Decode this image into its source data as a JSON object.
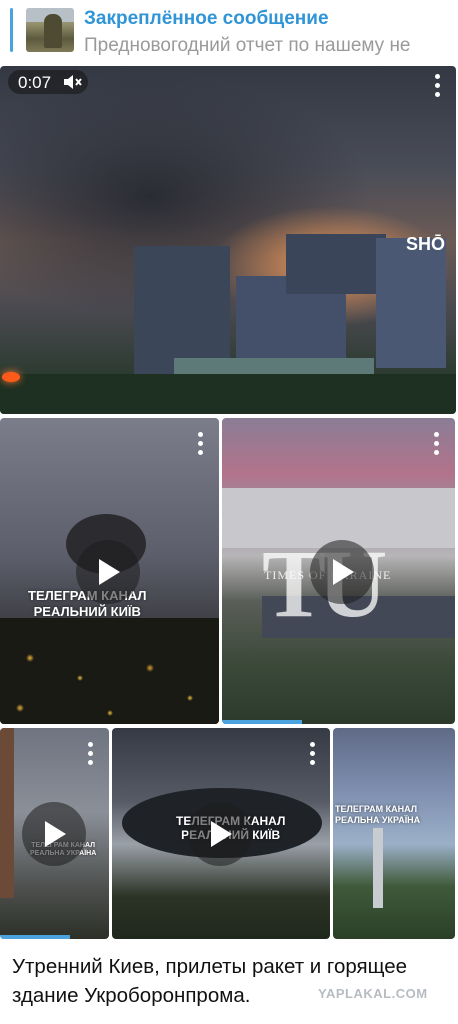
{
  "pinned": {
    "title": "Закреплённое сообщение",
    "text": "Предновогодний отчет по нашему не"
  },
  "media": [
    {
      "time": "0:07",
      "watermark": "SHŌ"
    },
    {
      "overlay": "ТЕЛЕГРАМ КАНАЛ\nРЕАЛЬНИЙ КИЇВ"
    },
    {
      "logo": "TU",
      "overlay": "TIMES OF UKRAINE"
    },
    {
      "overlay": "ТЕЛЕГРАМ КАНАЛ\nРЕАЛЬНА УКРАЇНА"
    },
    {
      "overlay": "ТЕЛЕГРАМ КАНАЛ\nРЕАЛЬНИЙ КИЇВ"
    },
    {
      "overlay": "ТЕЛЕГРАМ КАНАЛ\nРЕАЛЬНА УКРАЇНА"
    }
  ],
  "caption": "Утренний Киев, прилеты ракет и горящее здание Укроборонпрома.",
  "watermark": "YAPLAKAL.COM",
  "colors": {
    "accent": "#2f95d6",
    "progress": "#4aa3df"
  }
}
